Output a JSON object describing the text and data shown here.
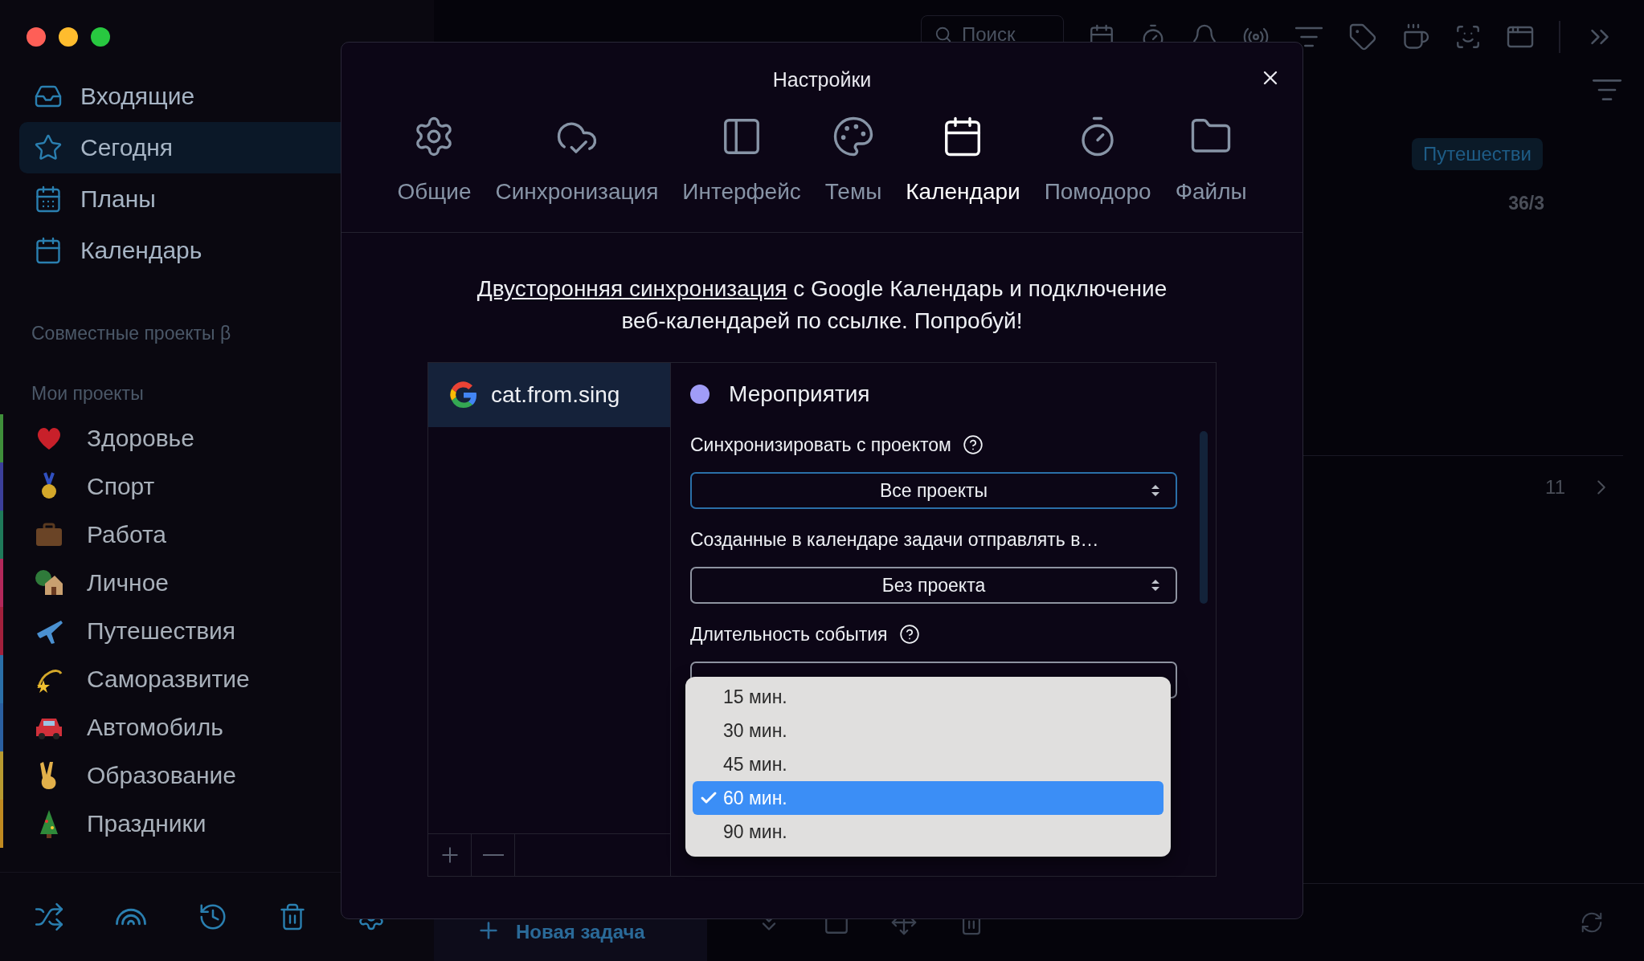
{
  "sidebar": {
    "nav": [
      {
        "label": "Входящие",
        "selected": false
      },
      {
        "label": "Сегодня",
        "selected": true
      },
      {
        "label": "Планы",
        "selected": false
      },
      {
        "label": "Календарь",
        "selected": false
      }
    ],
    "shared_heading": "Совместные проекты β",
    "projects_heading": "Мои проекты",
    "projects": [
      {
        "label": "Здоровье",
        "color": "#3f8f3a"
      },
      {
        "label": "Спорт",
        "color": "#3b3f9a"
      },
      {
        "label": "Работа",
        "color": "#1f7a5a"
      },
      {
        "label": "Личное",
        "color": "#b3285a"
      },
      {
        "label": "Путешествия",
        "color": "#a3203c"
      },
      {
        "label": "Саморазвитие",
        "color": "#2a6fa8"
      },
      {
        "label": "Автомобиль",
        "color": "#2a5fa0"
      },
      {
        "label": "Образование",
        "color": "#b89a30"
      },
      {
        "label": "Праздники",
        "color": "#c08a20"
      }
    ]
  },
  "toolbar": {
    "search": {
      "placeholder": "Поиск"
    }
  },
  "content": {
    "tag": "Путешестви",
    "count": "36/3",
    "page": "11",
    "new_task": "Новая задача"
  },
  "settings": {
    "title": "Настройки",
    "tabs": [
      {
        "label": "Общие",
        "selected": false
      },
      {
        "label": "Синхронизация",
        "selected": false
      },
      {
        "label": "Интерфейс",
        "selected": false
      },
      {
        "label": "Темы",
        "selected": false
      },
      {
        "label": "Календари",
        "selected": true
      },
      {
        "label": "Помодоро",
        "selected": false
      },
      {
        "label": "Файлы",
        "selected": false
      }
    ],
    "promo": {
      "link": "Двусторонняя синхронизация",
      "text": " с Google Календарь и подключение веб-календарей по ссылке. Попробуй!"
    },
    "accounts": [
      {
        "label": "cat.from.sing",
        "selected": true
      }
    ],
    "calendar": {
      "name": "Мероприятия",
      "color": "#a09cf7"
    },
    "fields": [
      {
        "label": "Синхронизировать с проектом",
        "help": true,
        "value": "Все проекты",
        "focused": true
      },
      {
        "label": "Созданные в календаре задачи отправлять в…",
        "help": false,
        "value": "Без проекта",
        "focused": false
      },
      {
        "label": "Длительность события",
        "help": true
      }
    ],
    "duration_options": [
      {
        "label": "15 мин.",
        "selected": false
      },
      {
        "label": "30 мин.",
        "selected": false
      },
      {
        "label": "45 мин.",
        "selected": false
      },
      {
        "label": "60 мин.",
        "selected": true
      },
      {
        "label": "90 мин.",
        "selected": false
      }
    ]
  }
}
